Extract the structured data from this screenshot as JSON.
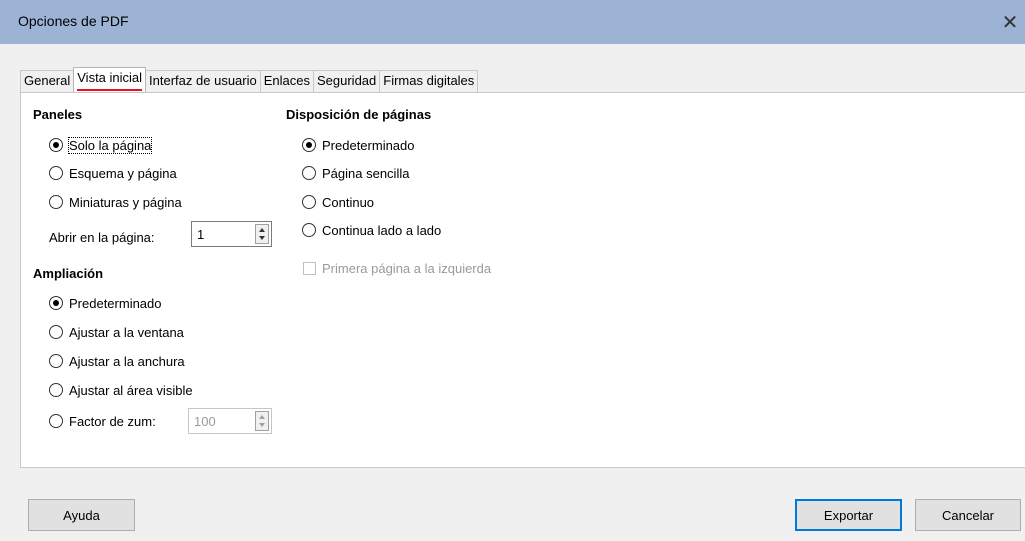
{
  "window": {
    "title": "Opciones de PDF",
    "close_glyph": "✕"
  },
  "tabs": [
    {
      "label": "General",
      "active": false
    },
    {
      "label": "Vista inicial",
      "active": true
    },
    {
      "label": "Interfaz de usuario",
      "active": false
    },
    {
      "label": "Enlaces",
      "active": false
    },
    {
      "label": "Seguridad",
      "active": false
    },
    {
      "label": "Firmas digitales",
      "active": false
    }
  ],
  "paneles": {
    "heading": "Paneles",
    "options": [
      {
        "label": "Solo la página",
        "checked": true
      },
      {
        "label": "Esquema y página",
        "checked": false
      },
      {
        "label": "Miniaturas y página",
        "checked": false
      }
    ],
    "open_page_label": "Abrir en la página:",
    "open_page_value": "1"
  },
  "ampliacion": {
    "heading": "Ampliación",
    "options": [
      {
        "label": "Predeterminado",
        "checked": true
      },
      {
        "label": "Ajustar a la ventana",
        "checked": false
      },
      {
        "label": "Ajustar a la anchura",
        "checked": false
      },
      {
        "label": "Ajustar al área visible",
        "checked": false
      },
      {
        "label": "Factor de zum:",
        "checked": false
      }
    ],
    "zoom_value": "100"
  },
  "disposicion": {
    "heading": "Disposición de páginas",
    "options": [
      {
        "label": "Predeterminado",
        "checked": true
      },
      {
        "label": "Página sencilla",
        "checked": false
      },
      {
        "label": "Continuo",
        "checked": false
      },
      {
        "label": "Continua lado a lado",
        "checked": false
      }
    ],
    "first_page_left_label": "Primera página a la izquierda",
    "first_page_left_checked": false
  },
  "buttons": {
    "help": "Ayuda",
    "export": "Exportar",
    "cancel": "Cancelar"
  },
  "colors": {
    "titlebar": "#9db3d6",
    "active_tab_underline": "#e81123",
    "default_button_border": "#0078d7"
  }
}
